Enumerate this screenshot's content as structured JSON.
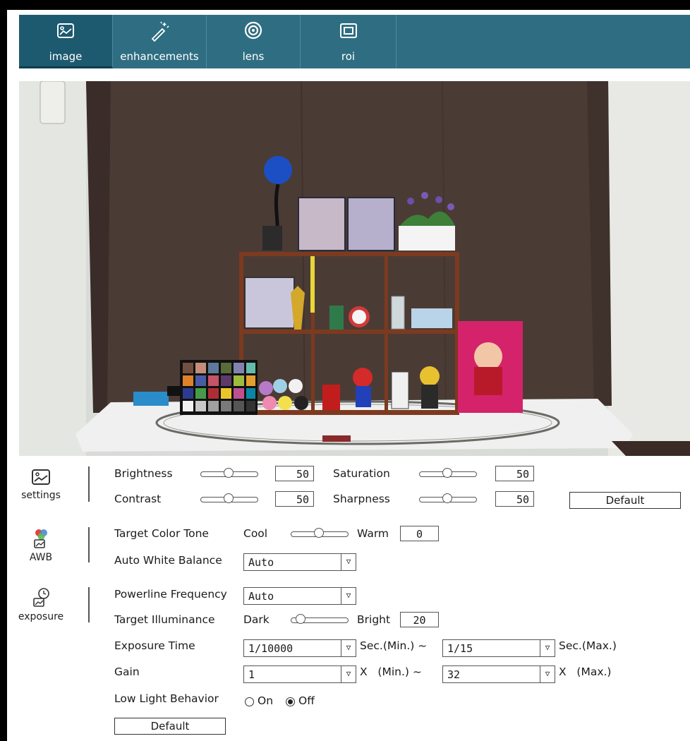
{
  "tabs": [
    {
      "label": "image",
      "icon": "image-icon"
    },
    {
      "label": "enhancements",
      "icon": "magic-wand-icon"
    },
    {
      "label": "lens",
      "icon": "lens-icon"
    },
    {
      "label": "roi",
      "icon": "roi-icon"
    }
  ],
  "settings": {
    "label": "settings",
    "brightness": {
      "label": "Brightness",
      "value": "50"
    },
    "saturation": {
      "label": "Saturation",
      "value": "50"
    },
    "contrast": {
      "label": "Contrast",
      "value": "50"
    },
    "sharpness": {
      "label": "Sharpness",
      "value": "50"
    },
    "default_label": "Default"
  },
  "awb": {
    "label": "AWB",
    "target_color_tone": {
      "label": "Target Color Tone",
      "min_label": "Cool",
      "max_label": "Warm",
      "value": "0"
    },
    "auto_white_balance": {
      "label": "Auto White Balance",
      "value": "Auto"
    }
  },
  "exposure": {
    "label": "exposure",
    "powerline_frequency": {
      "label": "Powerline Frequency",
      "value": "Auto"
    },
    "target_illuminance": {
      "label": "Target Illuminance",
      "min_label": "Dark",
      "max_label": "Bright",
      "value": "20"
    },
    "exposure_time": {
      "label": "Exposure Time",
      "min_value": "1/10000",
      "min_unit": "Sec.(Min.) ~",
      "max_value": "1/15",
      "max_unit": "Sec.(Max.)"
    },
    "gain": {
      "label": "Gain",
      "min_value": "1",
      "min_unit": "X   (Min.) ~",
      "max_value": "32",
      "max_unit": "X   (Max.)"
    },
    "low_light_behavior": {
      "label": "Low Light Behavior",
      "option_on": "On",
      "option_off": "Off",
      "selected": "Off"
    },
    "default_label": "Default"
  },
  "colors": {
    "tab_bar": "#2f6e82",
    "tab_active": "#1d5a6f"
  }
}
